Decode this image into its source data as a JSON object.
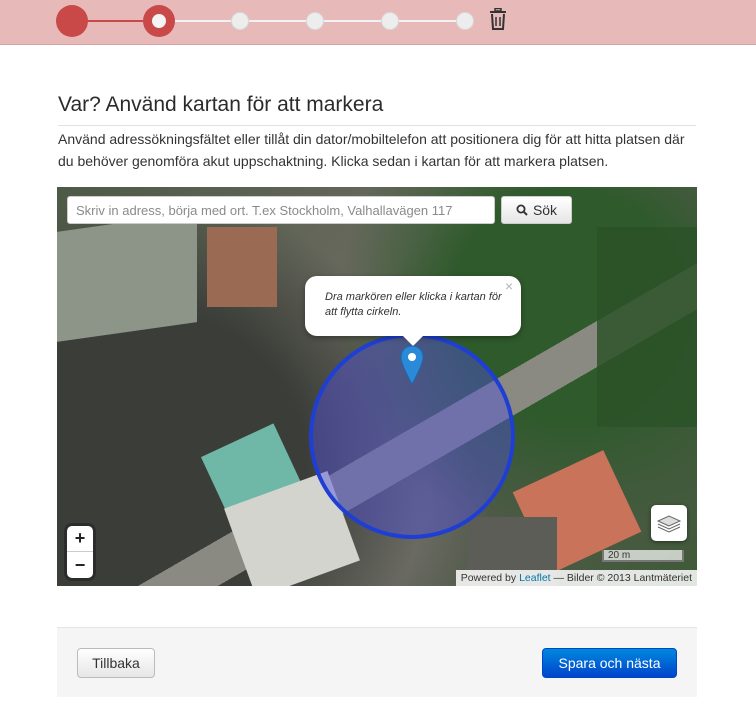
{
  "progress": {
    "steps": [
      "done",
      "current",
      "todo",
      "todo",
      "todo",
      "todo"
    ]
  },
  "heading": {
    "title": "Var? Använd kartan för att markera",
    "description": "Använd adressökningsfältet eller tillåt din dator/mobiltelefon att positionera dig för att hitta platsen där du behöver genomföra akut uppschaktning. Klicka sedan i kartan för att markera platsen."
  },
  "map": {
    "search_placeholder": "Skriv in adress, börja med ort. T.ex Stockholm, Valhallavägen 117",
    "search_button": "Sök",
    "popup_text": "Dra markören eller klicka i kartan för att flytta cirkeln.",
    "popup_close": "×",
    "zoom_in": "+",
    "zoom_out": "−",
    "scale_label": "20 m",
    "attribution_powered": "Powered by",
    "attribution_leaflet": "Leaflet",
    "attribution_rest": "— Bilder © 2013 Lantmäteriet"
  },
  "footer": {
    "back_label": "Tillbaka",
    "next_label": "Spara och nästa"
  },
  "colors": {
    "progress_bg": "#e8b9b9",
    "progress_active": "#c94848",
    "primary_button": "#0055cc",
    "circle": "#1f3fd4"
  }
}
